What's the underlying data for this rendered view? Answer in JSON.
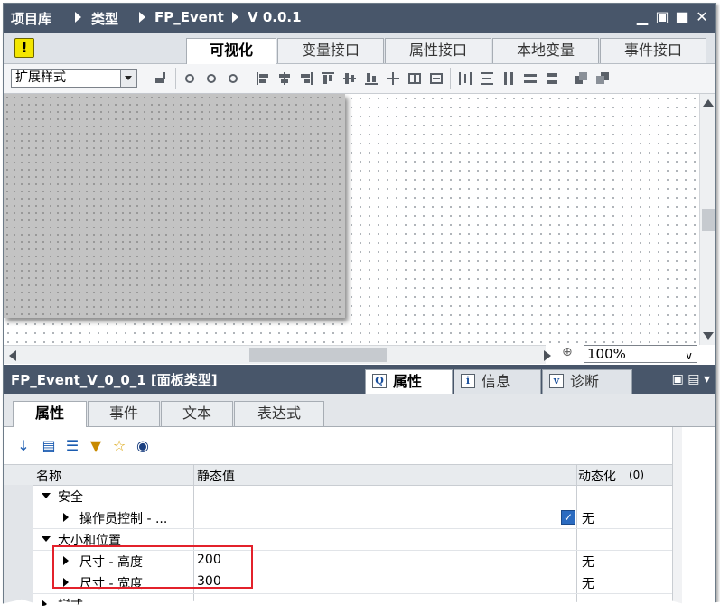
{
  "breadcrumb": [
    "项目库",
    "类型",
    "FP_Event",
    "V 0.0.1"
  ],
  "editor_tabs": [
    {
      "label": "可视化",
      "active": true
    },
    {
      "label": "变量接口",
      "active": false
    },
    {
      "label": "属性接口",
      "active": false
    },
    {
      "label": "本地变量",
      "active": false
    },
    {
      "label": "事件接口",
      "active": false
    }
  ],
  "toolbar": {
    "style_select": "扩展样式"
  },
  "zoom": {
    "value": "100%"
  },
  "inspector": {
    "title": "FP_Event_V_0_0_1 [面板类型]",
    "tabs": [
      {
        "label": "属性",
        "icon": "i",
        "active": true
      },
      {
        "label": "信息",
        "icon": "i",
        "active": false
      },
      {
        "label": "诊断",
        "icon": "v",
        "active": false
      }
    ],
    "subtabs": [
      {
        "label": "属性",
        "active": true
      },
      {
        "label": "事件",
        "active": false
      },
      {
        "label": "文本",
        "active": false
      },
      {
        "label": "表达式",
        "active": false
      }
    ],
    "columns": {
      "name": "名称",
      "static": "静态值",
      "dynamic": "动态化",
      "dynamic_count": "(0)"
    },
    "rows": [
      {
        "name": "安全",
        "value": "",
        "dynamic": "",
        "kind": "group"
      },
      {
        "name": "操作员控制 - ...",
        "value": "",
        "dynamic": "无",
        "kind": "item",
        "checked": true
      },
      {
        "name": "大小和位置",
        "value": "",
        "dynamic": "",
        "kind": "group"
      },
      {
        "name": "尺寸 - 高度",
        "value": "200",
        "dynamic": "无",
        "kind": "item"
      },
      {
        "name": "尺寸 - 宽度",
        "value": "300",
        "dynamic": "无",
        "kind": "item"
      },
      {
        "name": "样式",
        "value": "",
        "dynamic": "",
        "kind": "collapsed"
      }
    ]
  },
  "colors": {
    "header": "#48566a",
    "highlight": "#e3212b",
    "warning": "#f3e600",
    "checkbox": "#2b6bc0"
  }
}
